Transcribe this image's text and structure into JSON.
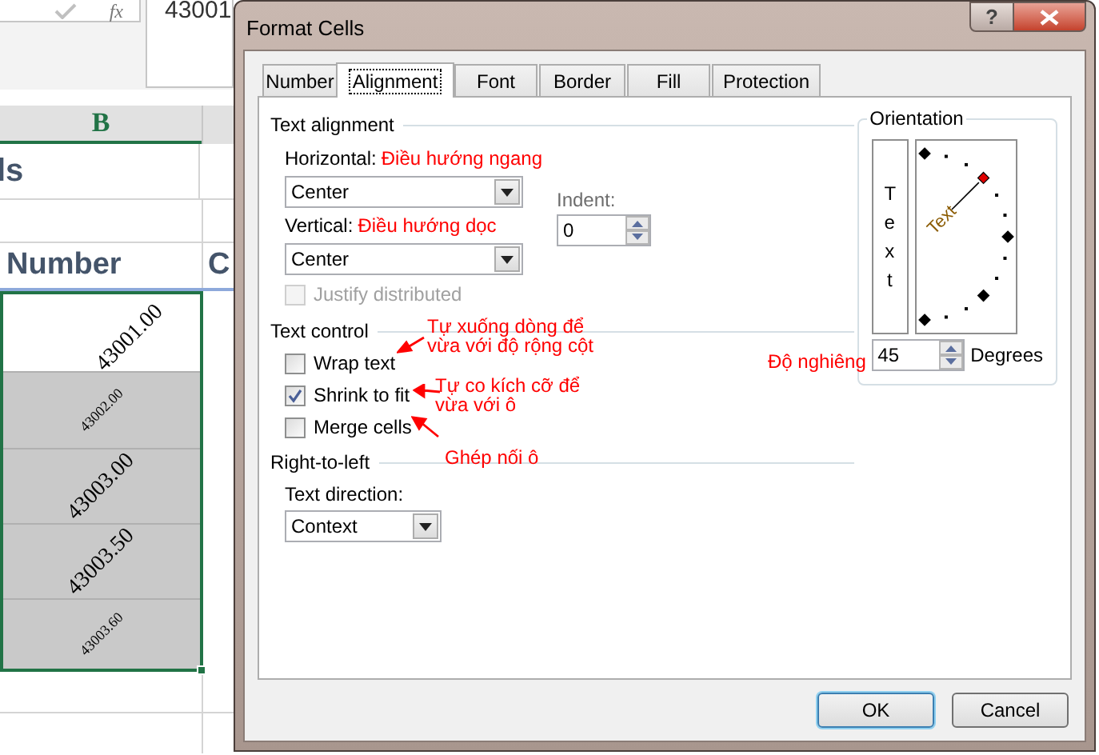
{
  "formula_bar": {
    "function_label": "fx",
    "value": "43001"
  },
  "sheet": {
    "column_header": "B",
    "title_fragment": "ls",
    "heading": "Number",
    "next_heading": "C",
    "cells": [
      {
        "text": "43001.00",
        "filled": false,
        "shrunk": false
      },
      {
        "text": "43002.00",
        "filled": true,
        "shrunk": true
      },
      {
        "text": "43003.00",
        "filled": true,
        "shrunk": false
      },
      {
        "text": "43003.50",
        "filled": true,
        "shrunk": false
      },
      {
        "text": "43003.60",
        "filled": true,
        "shrunk": true
      }
    ]
  },
  "dialog": {
    "title": "Format Cells",
    "help": "?",
    "tabs": [
      {
        "label": "Number",
        "selected": false
      },
      {
        "label": "Alignment",
        "selected": true
      },
      {
        "label": "Font",
        "selected": false
      },
      {
        "label": "Border",
        "selected": false
      },
      {
        "label": "Fill",
        "selected": false
      },
      {
        "label": "Protection",
        "selected": false
      }
    ],
    "text_alignment": {
      "heading": "Text alignment",
      "horizontal": {
        "label": "Horizontal:",
        "note": "Điều hướng ngang",
        "value": "Center"
      },
      "indent": {
        "label": "Indent:",
        "value": "0"
      },
      "vertical": {
        "label": "Vertical:",
        "note": "Điều hướng dọc",
        "value": "Center"
      },
      "justify_distributed": {
        "label": "Justify distributed",
        "checked": false,
        "disabled": true
      }
    },
    "text_control": {
      "heading": "Text control",
      "options": [
        {
          "label": "Wrap text",
          "checked": false
        },
        {
          "label": "Shrink to fit",
          "checked": true
        },
        {
          "label": "Merge cells",
          "checked": false
        }
      ]
    },
    "right_to_left": {
      "heading": "Right-to-left",
      "text_direction": {
        "label": "Text direction:",
        "value": "Context"
      }
    },
    "orientation": {
      "heading": "Orientation",
      "vertical_text": "Text",
      "dial_text": "Text",
      "degrees": "45",
      "degrees_label": "Degrees"
    },
    "annotations": [
      {
        "text": "Tự xuống dòng để\nvừa với độ rộng cột"
      },
      {
        "text": "Tự co kích cỡ để\nvừa với ô"
      },
      {
        "text": "Ghép nối ô"
      },
      {
        "text": "Độ nghiêng"
      }
    ],
    "buttons": [
      {
        "label": "OK",
        "default": true
      },
      {
        "label": "Cancel",
        "default": false
      }
    ]
  }
}
